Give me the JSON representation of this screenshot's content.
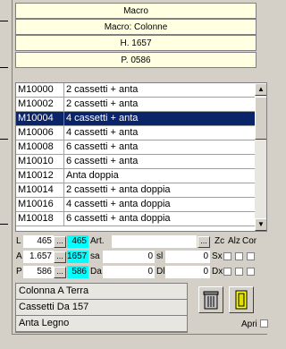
{
  "headers": [
    "Macro",
    "Macro: Colonne",
    "H. 1657",
    "P. 0586"
  ],
  "list": {
    "rows": [
      {
        "code": "M10000",
        "desc": "2 cassetti + anta",
        "selected": false
      },
      {
        "code": "M10002",
        "desc": "2 cassetti + anta",
        "selected": false
      },
      {
        "code": "M10004",
        "desc": "4 cassetti + anta",
        "selected": true
      },
      {
        "code": "M10006",
        "desc": "4 cassetti + anta",
        "selected": false
      },
      {
        "code": "M10008",
        "desc": "6 cassetti + anta",
        "selected": false
      },
      {
        "code": "M10010",
        "desc": "6 cassetti + anta",
        "selected": false
      },
      {
        "code": "M10012",
        "desc": "Anta doppia",
        "selected": false
      },
      {
        "code": "M10014",
        "desc": "2 cassetti + anta doppia",
        "selected": false
      },
      {
        "code": "M10016",
        "desc": "4 cassetti + anta doppia",
        "selected": false
      },
      {
        "code": "M10018",
        "desc": "6 cassetti + anta doppia",
        "selected": false
      }
    ]
  },
  "dims": {
    "L": {
      "label": "L",
      "value": "465",
      "cyan": "465",
      "field": "Art.",
      "dots": "...",
      "extra_label": "",
      "extra_value": ""
    },
    "A": {
      "label": "A",
      "value": "1.657",
      "cyan": "1657",
      "field": "sa",
      "dots": "...",
      "extra_label": "sl",
      "extra_value": "0",
      "field_value": "0"
    },
    "P": {
      "label": "P",
      "value": "586",
      "cyan": "586",
      "field": "Da",
      "dots": "...",
      "extra_label": "Dl",
      "extra_value": "0",
      "field_value": "0"
    }
  },
  "side_labels": {
    "zc": "Zc",
    "alz": "Alz",
    "cor": "Cor",
    "sx": "Sx",
    "dx": "Dx"
  },
  "lower": {
    "items": [
      "Colonna A Terra",
      "Cassetti Da 157",
      "Anta Legno"
    ],
    "apri_label": "Apri"
  },
  "colors": {
    "selection": "#0a246a",
    "header_bg": "#ffffe1",
    "cyan": "#00ffff",
    "panel": "#d4d0c8"
  }
}
